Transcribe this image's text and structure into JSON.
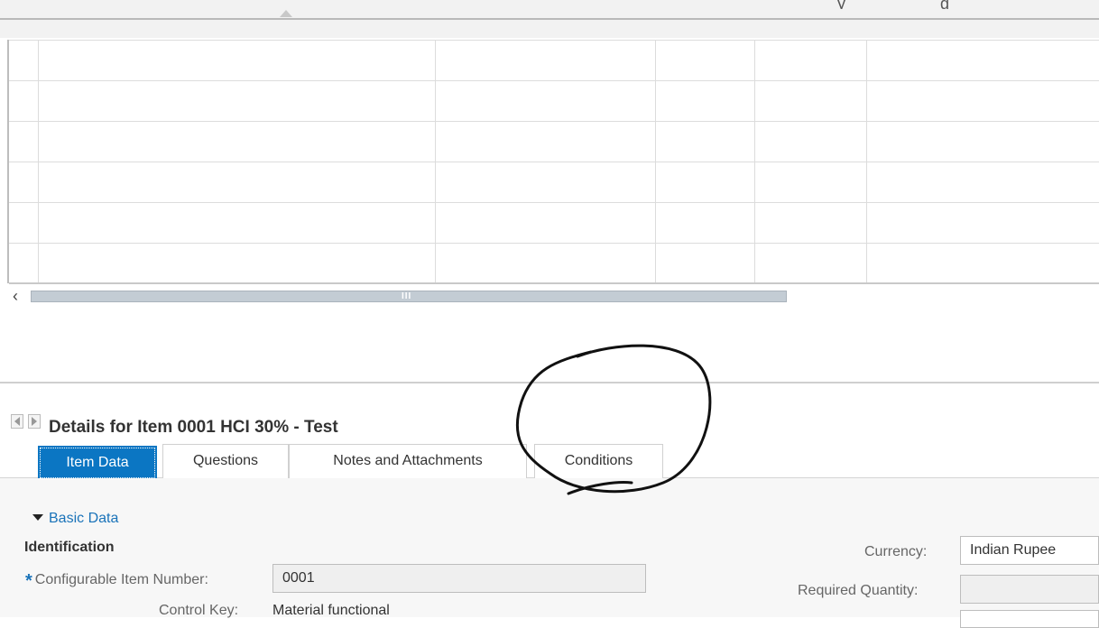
{
  "top": {
    "cut_text_1": "y",
    "cut_text_2": "g"
  },
  "table": {
    "rows": 6,
    "column_count": 6
  },
  "details": {
    "title": "Details for Item 0001 HCI 30% - Test",
    "tabs": [
      {
        "label": "Item Data",
        "active": true
      },
      {
        "label": "Questions",
        "active": false
      },
      {
        "label": "Notes and Attachments",
        "active": false
      },
      {
        "label": "Conditions",
        "active": false
      }
    ]
  },
  "basic_data": {
    "expander_label": "Basic Data",
    "section_title": "Identification",
    "configurable_item_number_label": "Configurable Item Number:",
    "configurable_item_number_value": "0001",
    "control_key_label": "Control Key:",
    "control_key_value": "Material functional",
    "currency_label": "Currency:",
    "currency_value": "Indian Rupee",
    "required_quantity_label": "Required Quantity:",
    "required_quantity_value": ""
  },
  "colors": {
    "active_tab": "#0b76c3",
    "link": "#1a73b9",
    "annotation": "#111111"
  }
}
